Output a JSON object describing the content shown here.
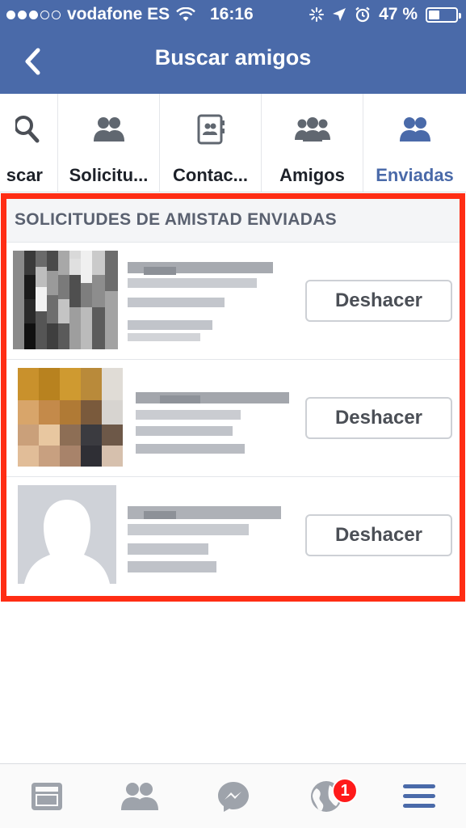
{
  "status_bar": {
    "carrier": "vodafone ES",
    "time": "16:16",
    "battery_percent": "47 %",
    "battery_level": 0.47,
    "signal_bars_filled": 3,
    "signal_bars_total": 5
  },
  "nav": {
    "title": "Buscar amigos",
    "back_icon": "chevron-left-icon"
  },
  "tabs": [
    {
      "label": "scar",
      "icon": "search-icon"
    },
    {
      "label": "Solicitu...",
      "icon": "friend-requests-icon"
    },
    {
      "label": "Contac...",
      "icon": "contacts-book-icon"
    },
    {
      "label": "Amigos",
      "icon": "friends-group-icon"
    },
    {
      "label": "Enviadas",
      "icon": "sent-requests-icon",
      "active": true
    }
  ],
  "section": {
    "title": "SOLICITUDES DE AMISTAD ENVIADAS"
  },
  "requests": [
    {
      "action_label": "Deshacer",
      "avatar": "pixelated-photo"
    },
    {
      "action_label": "Deshacer",
      "avatar": "pixelated-photo"
    },
    {
      "action_label": "Deshacer",
      "avatar": "default-silhouette"
    }
  ],
  "bottom_nav": {
    "items": [
      "news-feed-icon",
      "friends-icon",
      "messenger-icon",
      "notifications-globe-icon",
      "menu-icon"
    ],
    "notification_badge": "1"
  },
  "colors": {
    "header_blue": "#4a6aa9",
    "highlight_red": "#ff2d14",
    "badge_red": "#ff1a1a",
    "active_tab": "#4a6aa9"
  }
}
